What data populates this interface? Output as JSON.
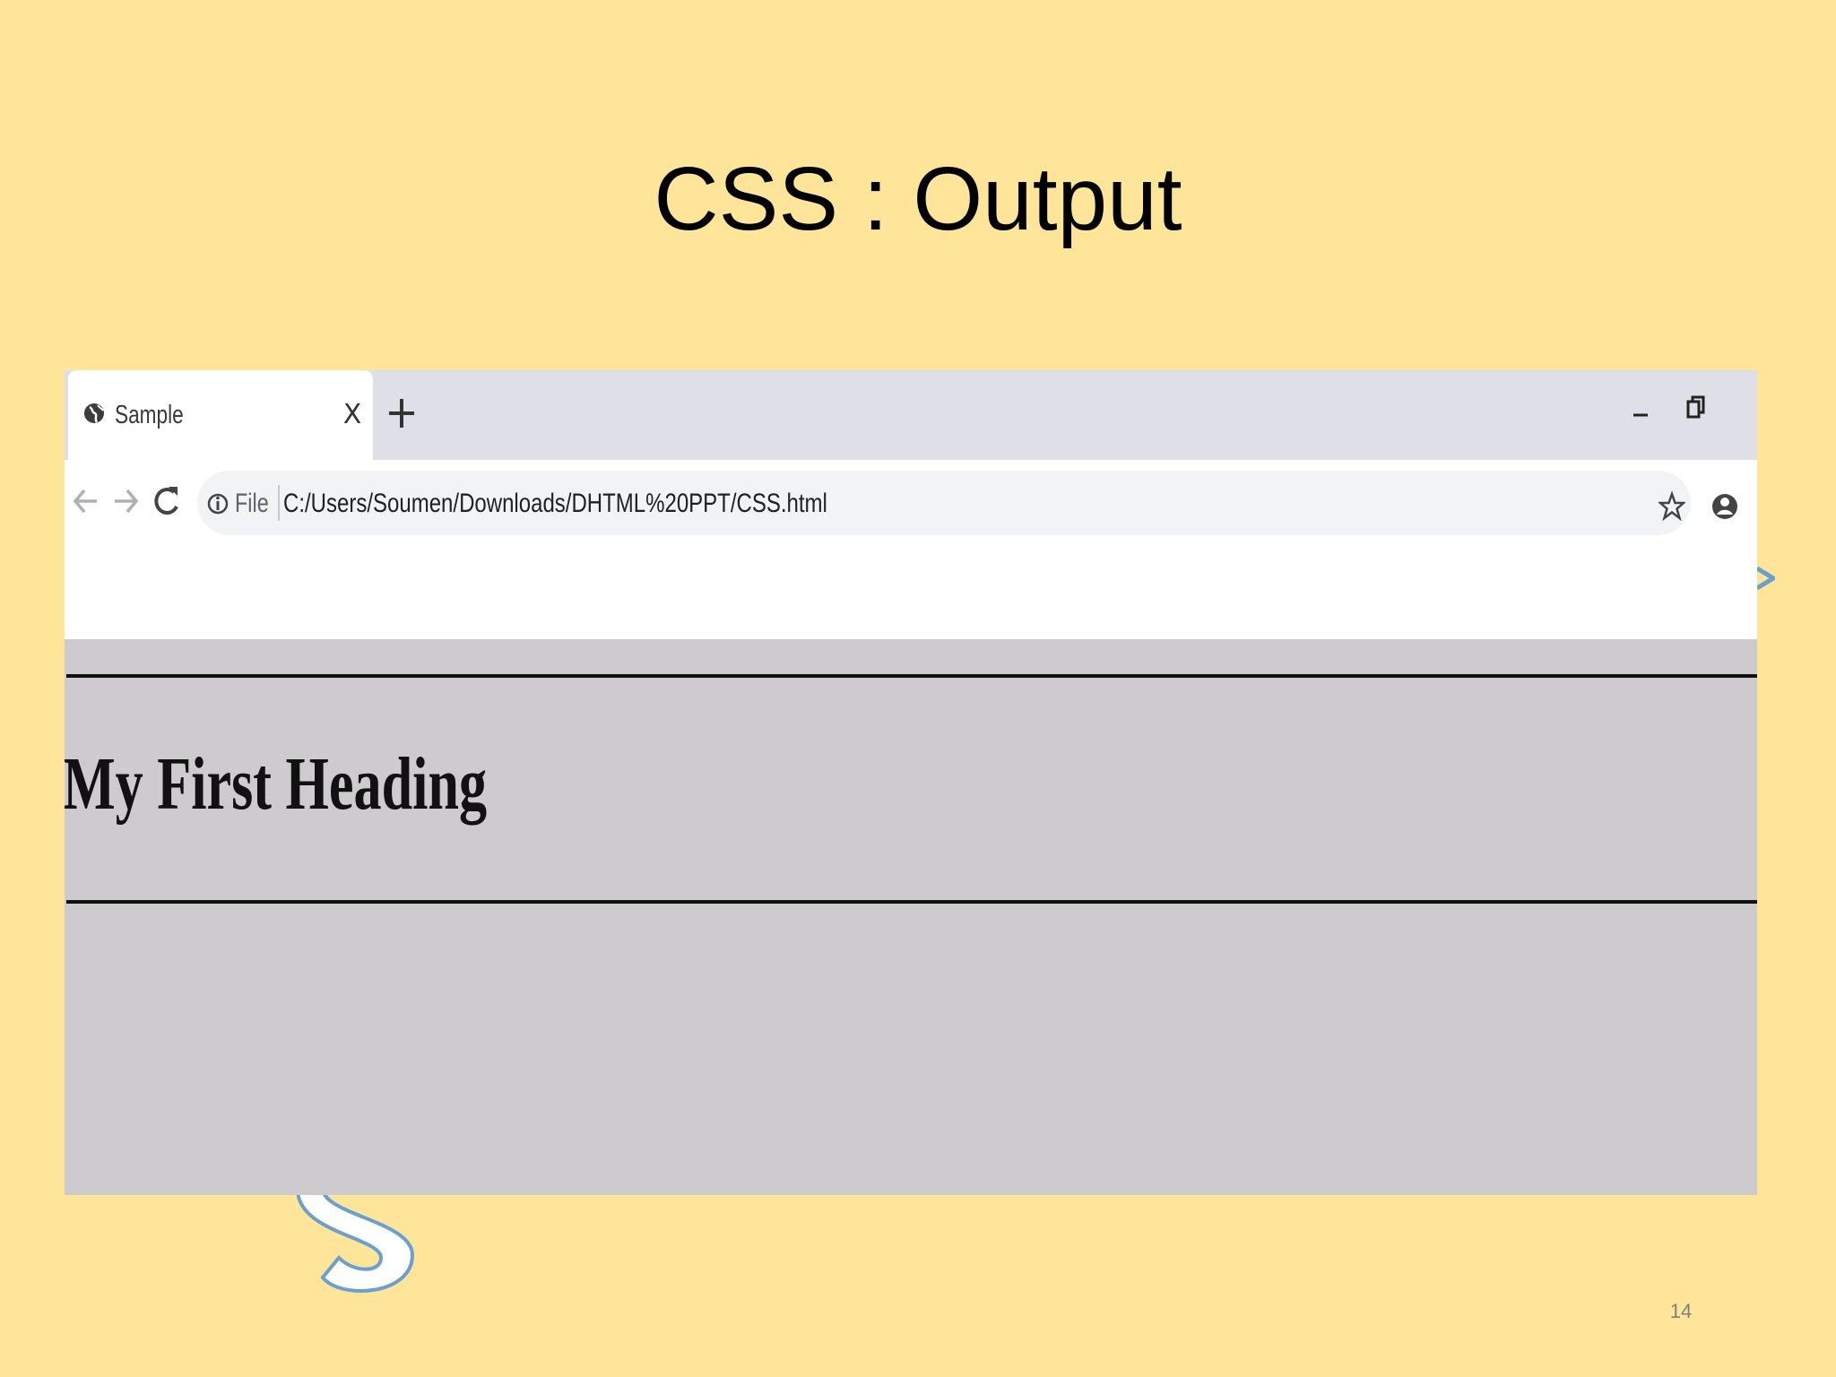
{
  "slide": {
    "title": "CSS : Output",
    "page_number": "14"
  },
  "browser": {
    "tab": {
      "title": "Sample",
      "close_label": "X"
    },
    "toolbar": {
      "scheme_label": "File",
      "url": "C:/Users/Soumen/Downloads/DHTML%20PPT/CSS.html"
    },
    "page": {
      "heading": "My First Heading",
      "background": "#cdcbcd"
    }
  },
  "colors": {
    "slide_background": "#fee599",
    "tabstrip": "#dfdfe8",
    "omnibox": "#f1f3f4",
    "deco_outline": "#6a9fd0"
  },
  "icons": {
    "favicon": "globe-icon",
    "new_tab": "plus-icon",
    "minimize": "minimize-icon",
    "restore": "restore-icon",
    "back": "arrow-left-icon",
    "forward": "arrow-right-icon",
    "reload": "reload-icon",
    "info": "info-icon",
    "bookmark": "star-icon",
    "profile": "profile-icon"
  }
}
